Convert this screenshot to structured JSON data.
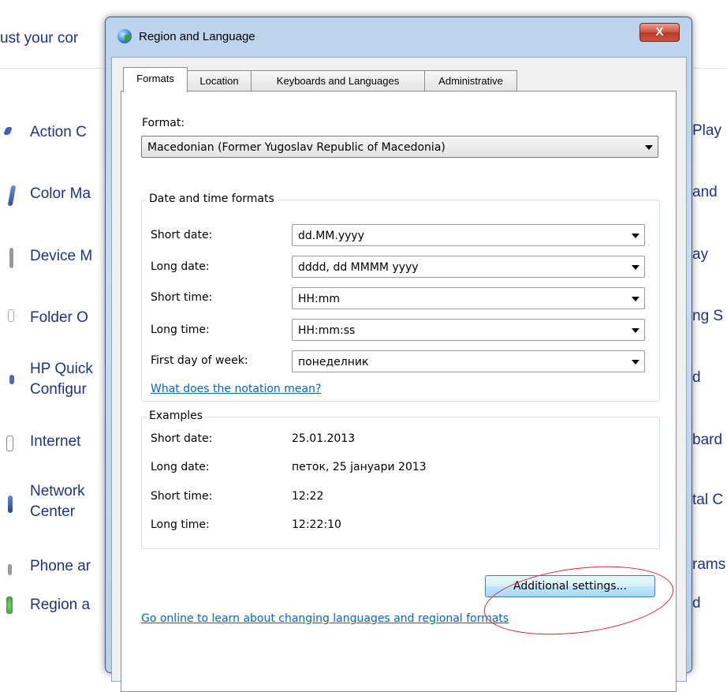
{
  "background": {
    "header_partial": "ust your cor",
    "items": [
      {
        "label": "Action C",
        "icon": "flag-icon",
        "color": "#3a62b8"
      },
      {
        "label": "Color Ma",
        "icon": "color-management-icon",
        "color": "#4a70c0"
      },
      {
        "label": "Device M",
        "icon": "device-manager-icon",
        "color": "#8a8a8a"
      },
      {
        "label": "Folder O",
        "icon": "folder-options-icon",
        "color": "#b0b0b0"
      },
      {
        "label": "HP Quick",
        "label2": "Configur",
        "icon": "hp-quick-icon",
        "color": "#4a6aa8"
      },
      {
        "label": "Internet",
        "icon": "internet-options-icon",
        "color": "#8a8a8a"
      },
      {
        "label": "Network",
        "label2": "Center",
        "icon": "network-icon",
        "color": "#3a62b8"
      },
      {
        "label": "Phone ar",
        "icon": "phone-icon",
        "color": "#9a9a9a"
      },
      {
        "label": "Region a",
        "icon": "region-icon",
        "color": "#3a9a3a"
      }
    ],
    "right_column": [
      "Play",
      "and",
      "ay",
      "ng S",
      "d",
      "bard",
      "tal C",
      "rams",
      "d"
    ]
  },
  "dialog": {
    "title": "Region and Language",
    "close_label": "X",
    "tabs": [
      "Formats",
      "Location",
      "Keyboards and Languages",
      "Administrative"
    ],
    "format_label": "Format:",
    "format_value": "Macedonian (Former Yugoslav Republic of Macedonia)",
    "date_time_group": "Date and time formats",
    "fields": [
      {
        "label": "Short date:",
        "value": "dd.MM.yyyy"
      },
      {
        "label": "Long date:",
        "value": "dddd, dd MMMM yyyy"
      },
      {
        "label": "Short time:",
        "value": "HH:mm"
      },
      {
        "label": "Long time:",
        "value": "HH:mm:ss"
      },
      {
        "label": "First day of week:",
        "value": "понеделник"
      }
    ],
    "notation_link": "What does the notation mean?",
    "examples_group": "Examples",
    "examples": [
      {
        "label": "Short date:",
        "value": "25.01.2013"
      },
      {
        "label": "Long date:",
        "value": "петок, 25 јануари 2013"
      },
      {
        "label": "Short time:",
        "value": "12:22"
      },
      {
        "label": "Long time:",
        "value": "12:22:10"
      }
    ],
    "additional_settings": "Additional settings...",
    "online_link": "Go online to learn about changing languages and regional formats"
  }
}
